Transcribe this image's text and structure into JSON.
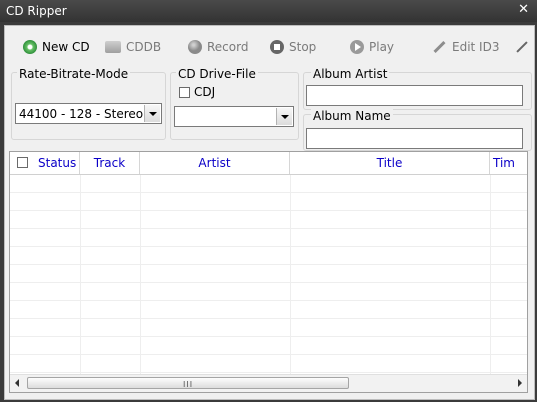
{
  "window": {
    "title": "CD Ripper",
    "close_glyph": "✕"
  },
  "toolbar": {
    "items": [
      {
        "label": "New CD",
        "icon": "new-cd-icon",
        "enabled": true
      },
      {
        "label": "CDDB",
        "icon": "cddb-icon",
        "enabled": false
      },
      {
        "label": "Record",
        "icon": "record-icon",
        "enabled": false
      },
      {
        "label": "Stop",
        "icon": "stop-icon",
        "enabled": false
      },
      {
        "label": "Play",
        "icon": "play-icon",
        "enabled": false
      },
      {
        "label": "Edit ID3",
        "icon": "edit-id3-icon",
        "enabled": false
      }
    ]
  },
  "settings": {
    "rate_bitrate_mode": {
      "label": "Rate-Bitrate-Mode",
      "value": "44100 - 128 - Stereo"
    },
    "cd_drive_file": {
      "label": "CD Drive-File",
      "cdj_label": "CDJ",
      "cdj_checked": false,
      "value": ""
    },
    "album_artist": {
      "label": "Album Artist",
      "value": ""
    },
    "album_name": {
      "label": "Album Name",
      "value": ""
    }
  },
  "grid": {
    "select_all_checked": false,
    "columns": [
      "Status",
      "Track",
      "Artist",
      "Title",
      "Tim"
    ],
    "rows": []
  },
  "colors": {
    "header_text": "#0b00c8",
    "title_bar": "#3b3b3b"
  },
  "scrollbar": {
    "grip": "III"
  }
}
